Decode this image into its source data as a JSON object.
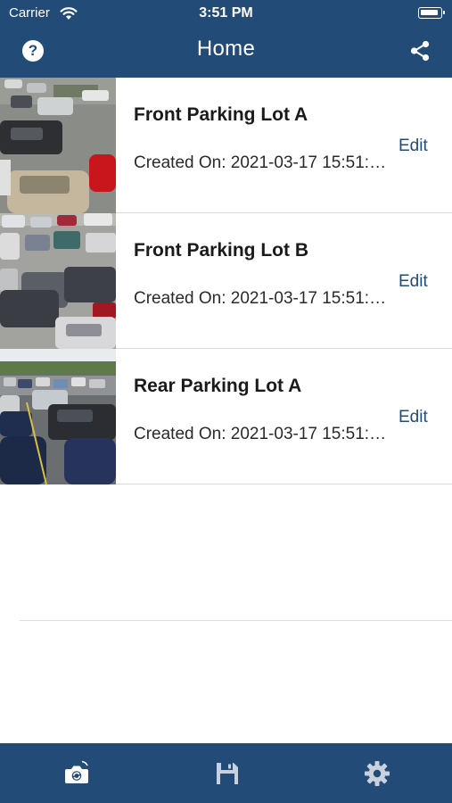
{
  "status_bar": {
    "carrier": "Carrier",
    "time": "3:51 PM"
  },
  "nav": {
    "title": "Home",
    "help_icon": "question-circle-icon",
    "share_icon": "share-icon"
  },
  "lots": [
    {
      "title": "Front Parking Lot A",
      "created": "Created On: 2021-03-17 15:51:…",
      "edit_label": "Edit"
    },
    {
      "title": "Front Parking Lot B",
      "created": "Created On: 2021-03-17 15:51:…",
      "edit_label": "Edit"
    },
    {
      "title": "Rear Parking Lot A",
      "created": "Created On: 2021-03-17 15:51:…",
      "edit_label": "Edit"
    }
  ],
  "tab_bar": {
    "items": [
      {
        "icon": "camera-rotate-icon"
      },
      {
        "icon": "floppy-disk-icon"
      },
      {
        "icon": "gear-icon"
      }
    ]
  },
  "colors": {
    "brand": "#234b78",
    "link": "#234b78",
    "background": "#ffffff"
  }
}
